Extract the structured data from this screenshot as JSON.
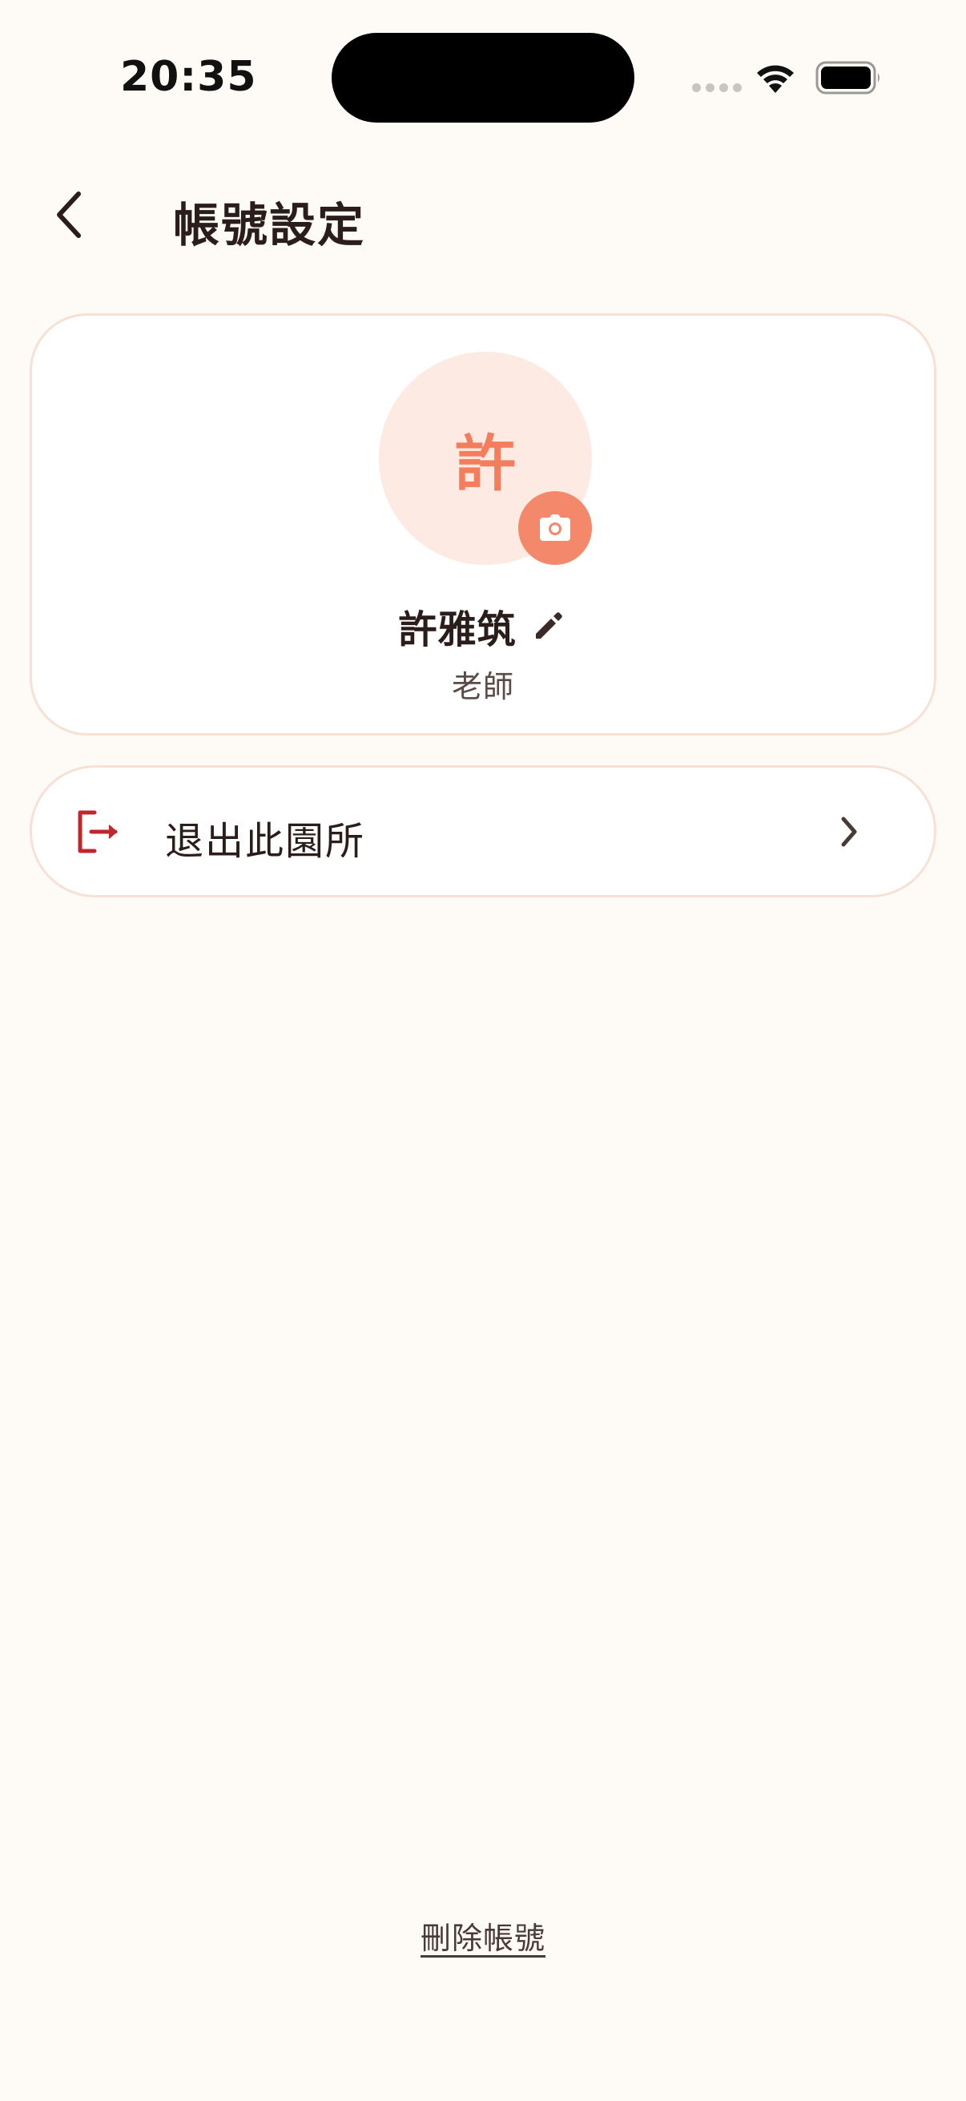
{
  "status_bar": {
    "time": "20:35"
  },
  "header": {
    "title": "帳號設定",
    "back_icon": "chevron-left-icon"
  },
  "profile": {
    "avatar_initial": "許",
    "name": "許雅筑",
    "role": "老師",
    "camera_icon": "camera-icon",
    "edit_icon": "pencil-icon"
  },
  "actions": {
    "leave_label": "退出此園所",
    "leave_icon": "logout-icon",
    "chevron_icon": "chevron-right-icon"
  },
  "footer": {
    "delete_account_label": "刪除帳號"
  },
  "colors": {
    "background": "#FEFAF5",
    "accent": "#F4886A",
    "avatar_bg": "#FDEAE3",
    "card_border": "#F7E1D6",
    "danger": "#C0262D",
    "text": "#2B1D1A"
  }
}
